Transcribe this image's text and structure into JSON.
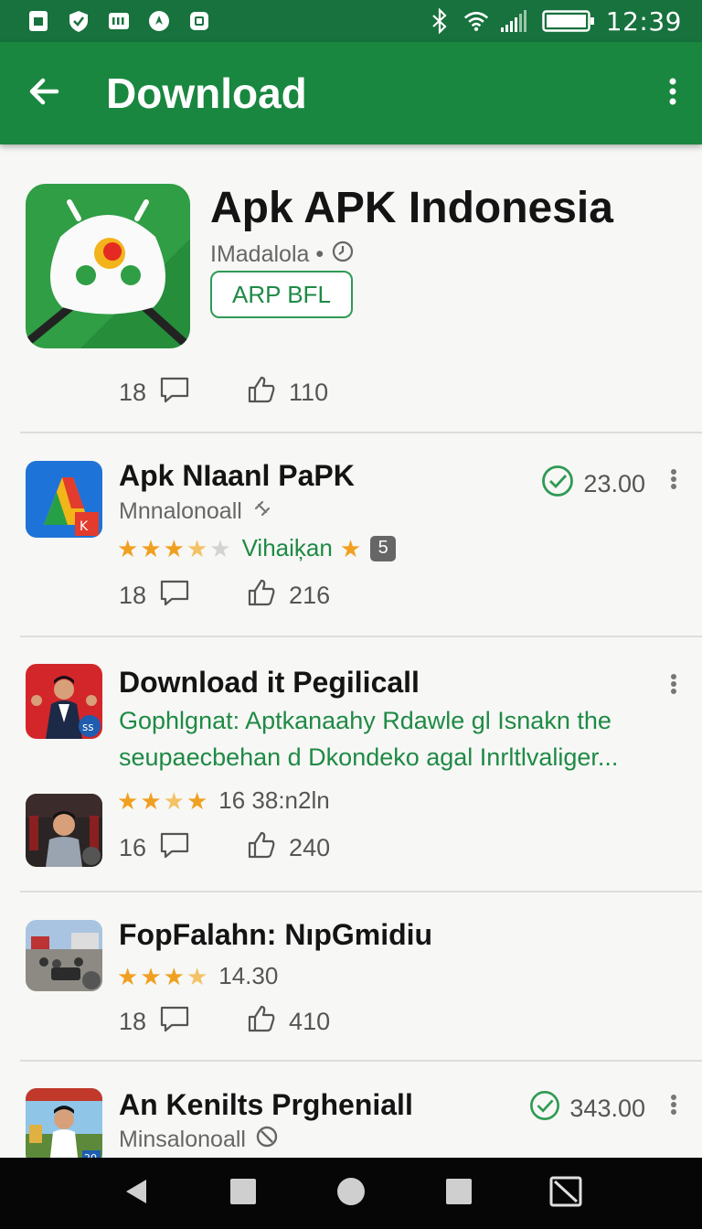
{
  "status_bar": {
    "time": "12:39",
    "left_icons": [
      "sim-card-icon",
      "shield-icon",
      "sd-card-icon",
      "location-icon",
      "clipboard-icon"
    ],
    "right_icons": [
      "bluetooth-icon",
      "wifi-icon",
      "signal-icon",
      "battery-icon"
    ]
  },
  "app_bar": {
    "title": "Download",
    "back_icon": "arrow-left-icon",
    "menu_icon": "more-vert-icon"
  },
  "hero": {
    "title": "Apk APK Indonesia",
    "developer": "IMadalola •",
    "badge": "ARP BFL",
    "comments": "18",
    "likes": "110"
  },
  "items": [
    {
      "title": "Apk NIaanl PaPK",
      "developer": "Mnnalonoall",
      "price": "23.00",
      "rating_stars": 3.5,
      "rating_label": "Vihaiķan",
      "rating_badge": "5",
      "comments": "18",
      "likes": "216"
    },
    {
      "title": "Download it Pegilicall",
      "description": "Gophlgnat: Aptkanaahy Rdawle gl Isnakn the seupaecbehan d Dkondeko agal Inrltlvaliger...",
      "rating_stars": 3.5,
      "rating_label": "16 38:n2ln",
      "comments": "16",
      "likes": "240"
    },
    {
      "title": "FopFalahn: NıpGmidiu",
      "rating_stars": 3.5,
      "rating_label": "14.30",
      "comments": "18",
      "likes": "410"
    },
    {
      "title": "An Kenilts Prgheniall",
      "developer": "Minsalonoall",
      "price": "343.00"
    }
  ],
  "colors": {
    "status_bar": "#17723d",
    "app_bar": "#19873f",
    "accent_green": "#1e8a45",
    "star": "#f0a020"
  }
}
